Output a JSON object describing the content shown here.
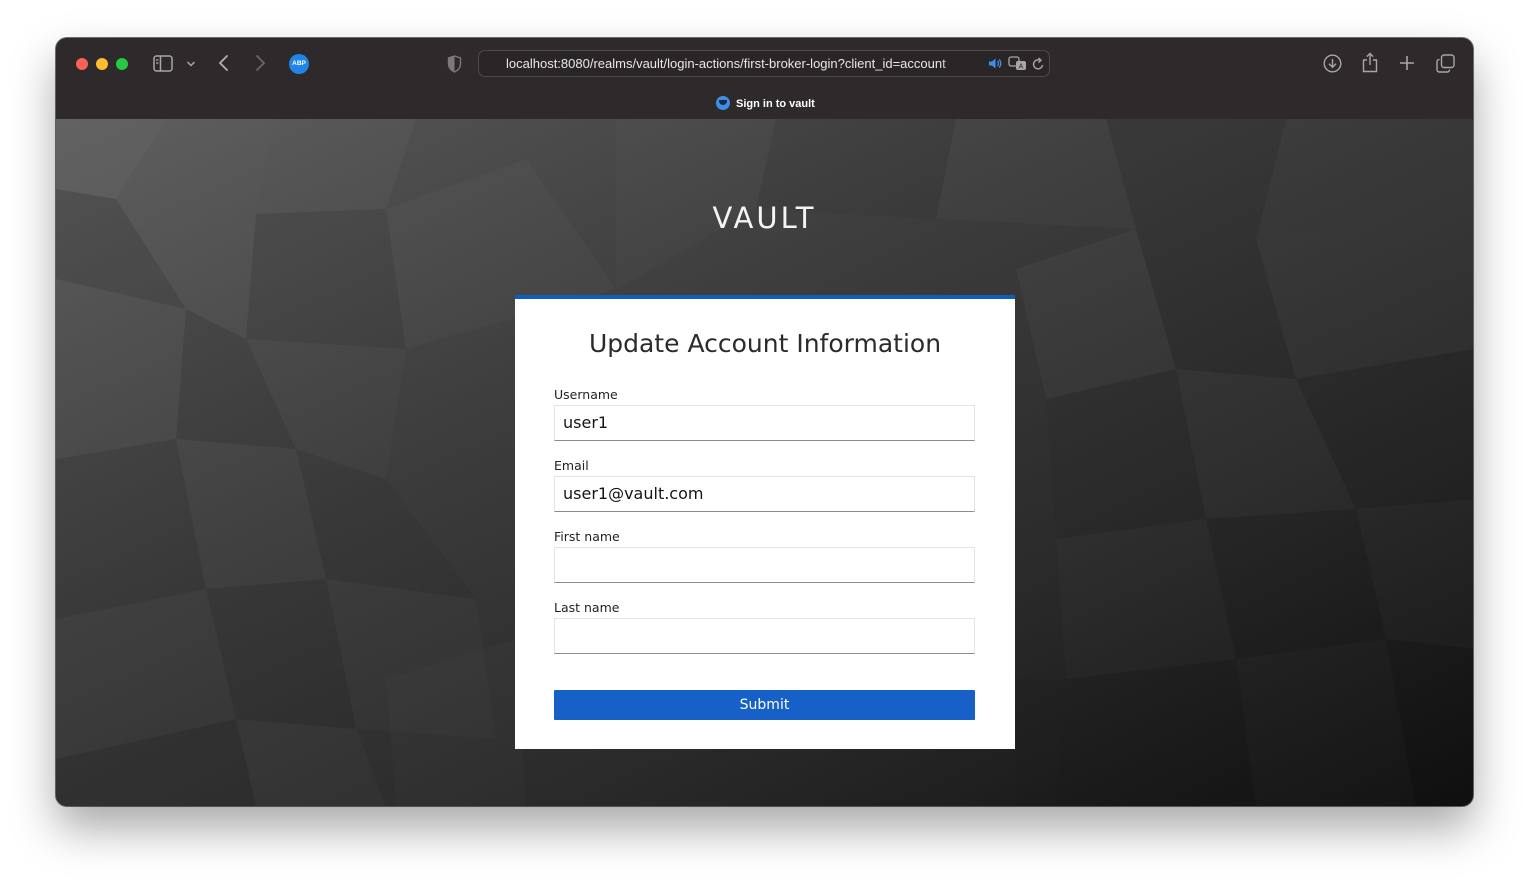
{
  "browser": {
    "url": "localhost:8080/realms/vault/login-actions/first-broker-login?client_id=account",
    "tab_title": "Sign in to vault",
    "extension_badge": "ABP"
  },
  "page": {
    "brand": "VAULT",
    "form": {
      "title": "Update Account Information",
      "fields": [
        {
          "label": "Username",
          "value": "user1"
        },
        {
          "label": "Email",
          "value": "user1@vault.com"
        },
        {
          "label": "First name",
          "value": ""
        },
        {
          "label": "Last name",
          "value": ""
        }
      ],
      "submit_label": "Submit"
    }
  },
  "colors": {
    "accent": "#1660c7",
    "titlebar": "#2e2a2b",
    "traffic_close": "#ff5f57",
    "traffic_minimize": "#febc2e",
    "traffic_maximize": "#28c840"
  }
}
